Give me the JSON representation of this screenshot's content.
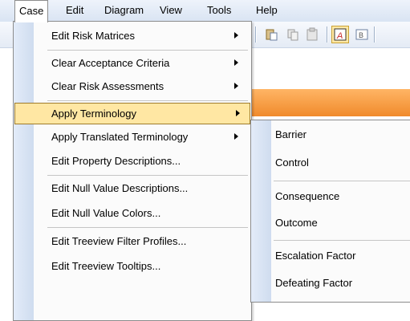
{
  "menubar": [
    {
      "label": "Case",
      "active": true
    },
    {
      "label": "Edit"
    },
    {
      "label": "Diagram"
    },
    {
      "label": "View"
    },
    {
      "label": "Tools"
    },
    {
      "label": "Help"
    }
  ],
  "case_menu": {
    "items": [
      {
        "label": "Edit Risk Matrices",
        "submenu": true
      },
      {
        "label": "Clear Acceptance Criteria",
        "submenu": true
      },
      {
        "label": "Clear Risk Assessments",
        "submenu": true
      },
      {
        "label": "Apply Terminology",
        "submenu": true,
        "highlighted": true
      },
      {
        "label": "Apply Translated Terminology",
        "submenu": true
      },
      {
        "label": "Edit Property Descriptions..."
      },
      {
        "label": "Edit Null Value Descriptions..."
      },
      {
        "label": "Edit Null Value Colors..."
      },
      {
        "label": "Edit Treeview Filter Profiles..."
      },
      {
        "label": "Edit Treeview Tooltips..."
      }
    ]
  },
  "terminology_submenu": {
    "items": [
      {
        "label": "Barrier"
      },
      {
        "label": "Control"
      },
      {
        "label": "Consequence"
      },
      {
        "label": "Outcome"
      },
      {
        "label": "Escalation Factor"
      },
      {
        "label": "Defeating Factor"
      }
    ]
  },
  "toolbar": {
    "icons": [
      "paste-icon",
      "copy-icon",
      "clipboard-icon",
      "text-frame-icon",
      "text-box-icon"
    ]
  },
  "colors": {
    "highlight": "#ffe7a3",
    "highlight_border": "#9e7b2c",
    "orange_band": "#f08a2b"
  }
}
